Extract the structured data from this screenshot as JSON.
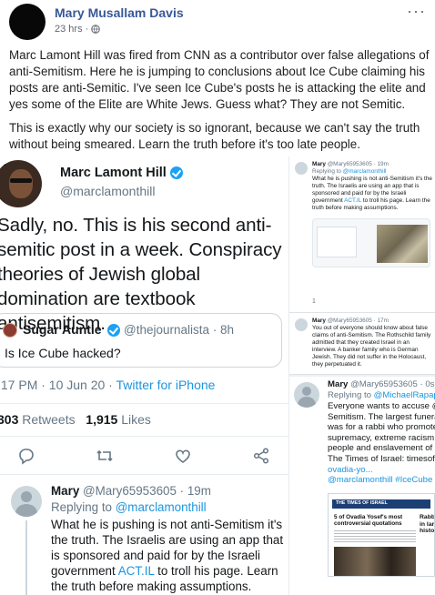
{
  "post": {
    "author": "Mary Musallam Davis",
    "time": "23 hrs",
    "dot": "·",
    "more": "···",
    "paragraph1": "Marc Lamont Hill was fired from CNN as a contributor over false allegations of anti-Semitism. Here he is jumping to conclusions about Ice Cube claiming his posts are anti-Semitic. I've seen Ice Cube's posts he is attacking the elite and yes some of the Elite are White Jews. Guess what? They are not Semitic.",
    "paragraph2": "This is exactly why our society is so ignorant, because we can't say the truth without being smeared. Learn the truth before it's too late people."
  },
  "main_tweet": {
    "avatar_tag": "OL",
    "name": "Marc Lamont Hill",
    "handle": "@marclamonthill",
    "text": "Sadly, no. This is his second anti-semitic post in a week. Conspiracy theories of Jewish global domination are textbook antisemitism.",
    "quote_name": "Sugar Auntie",
    "quote_handle": "@thejournalista · 8h",
    "quote_text": "Is Ice Cube hacked?",
    "time": ":17 PM · 10 Jun 20 · ",
    "source": "Twitter for iPhone",
    "retweets": "303",
    "retweets_label": " Retweets",
    "likes": "1,915",
    "likes_label": " Likes"
  },
  "reply_tweet": {
    "name": "Mary",
    "handle_time": " @Mary65953605 · 19m",
    "replying_prefix": "Replying to ",
    "replying_handle": "@marclamonthill",
    "text_before_link": "What he is pushing is not anti-Semitism it's the truth. The Israelis are using an app that is sponsored and paid for by the Israeli government ",
    "link": "ACT.IL",
    "text_after_link": " to troll his page. Learn the truth before making assumptions."
  },
  "mini1": {
    "name": "Mary",
    "handle_time": " @Mary65953605 · 19m",
    "replying_prefix": "Replying to ",
    "replying_handle": "@marclamonthill",
    "text_before_link": "What he is pushing is not anti-Semitism it's the truth. The Israelis are using an app that is sponsored and paid for by the Israeli government ",
    "link": "ACT.IL",
    "text_after_link": " to troll his page. Learn the truth before making assumptions.",
    "reply_count": "1"
  },
  "mini2": {
    "name": "Mary",
    "handle_time": " @Mary65953605 · 17m",
    "text": "You out of everyone should know about false claims of anti-Semitism. The Rothschild family admitted that they created Israel in an interview. A banker family who is German Jewish. They did not suffer in the Holocaust, they perpetuated it."
  },
  "mini3": {
    "name": "Mary",
    "handle_time": " @Mary65953605 · 0s",
    "replying_prefix": "Replying to ",
    "replying_handle": "@MichaelRapapo",
    "lines": [
      "Everyone wants to accuse @",
      "Semitism. The largest funeral",
      "was for a rabbi who promoted",
      "supremacy, extreme racism to",
      "people and enslavement of g",
      "The Times of Israel: timesofis",
      "ovadia-yo...",
      "@marclamonthill #IceCube"
    ],
    "news_brand": "THE TIMES OF ISRAEL",
    "news_brand2": "THE TI",
    "news_headline": "5 of Ovadia Yosef's most controversial quotations",
    "news_side": "Rabbi\nin larg\nhistor"
  },
  "colors": {
    "fb_blue": "#385898",
    "twitter_blue": "#1da1f2",
    "link_blue": "#1b95e0"
  }
}
